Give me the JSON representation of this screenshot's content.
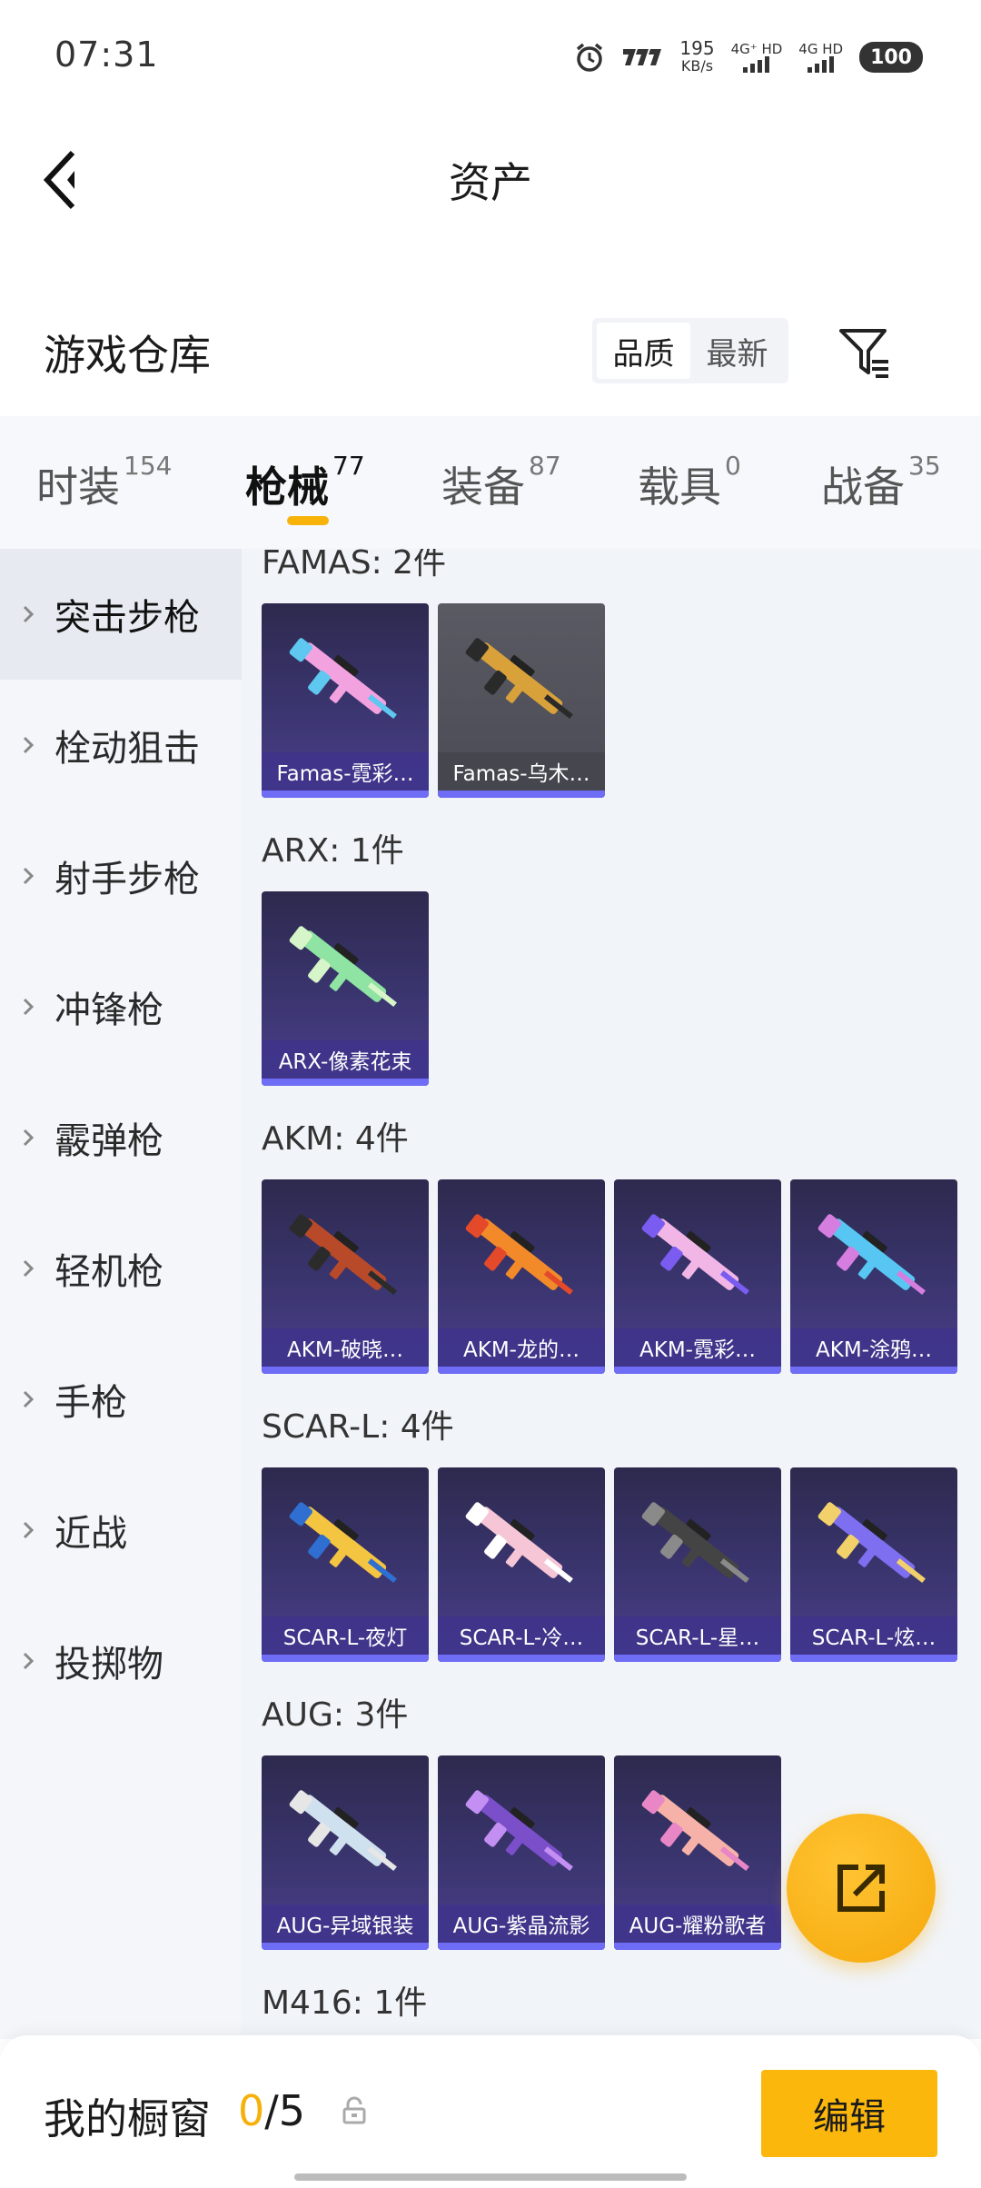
{
  "status_bar": {
    "time": "07:31",
    "speed_value": "195",
    "speed_unit": "KB/s",
    "net1": "4G⁺ HD",
    "net2": "4G HD",
    "battery": "100"
  },
  "header": {
    "title": "资产"
  },
  "section": {
    "title": "游戏仓库",
    "sort_quality": "品质",
    "sort_newest": "最新"
  },
  "tabs": [
    {
      "label": "时装",
      "count": "154"
    },
    {
      "label": "枪械",
      "count": "77"
    },
    {
      "label": "装备",
      "count": "87"
    },
    {
      "label": "载具",
      "count": "0"
    },
    {
      "label": "战备",
      "count": "35"
    }
  ],
  "sidebar": [
    {
      "label": "突击步枪"
    },
    {
      "label": "栓动狙击"
    },
    {
      "label": "射手步枪"
    },
    {
      "label": "冲锋枪"
    },
    {
      "label": "霰弹枪"
    },
    {
      "label": "轻机枪"
    },
    {
      "label": "手枪"
    },
    {
      "label": "近战"
    },
    {
      "label": "投掷物"
    }
  ],
  "groups": [
    {
      "title": "FAMAS: 2件",
      "items": [
        "Famas-霓彩…",
        "Famas-乌木…"
      ]
    },
    {
      "title": "ARX: 1件",
      "items": [
        "ARX-像素花束"
      ]
    },
    {
      "title": "AKM: 4件",
      "items": [
        "AKM-破晓…",
        "AKM-龙的…",
        "AKM-霓彩…",
        "AKM-涂鸦…"
      ]
    },
    {
      "title": "SCAR-L: 4件",
      "items": [
        "SCAR-L-夜灯",
        "SCAR-L-冷…",
        "SCAR-L-星…",
        "SCAR-L-炫…"
      ]
    },
    {
      "title": "AUG: 3件",
      "items": [
        "AUG-异域银装",
        "AUG-紫晶流影",
        "AUG-耀粉歌者"
      ]
    },
    {
      "title": "M416: 1件",
      "items": [
        ""
      ]
    }
  ],
  "bottom": {
    "showcase_label": "我的橱窗",
    "showcase_current": "0",
    "showcase_total": "/5",
    "edit_label": "编辑"
  },
  "colors": {
    "accent": "#fbb70b",
    "card_bg": "#3b3570",
    "card_stripe": "#6f6cf5"
  },
  "icons": {
    "back": "back-arrow-icon",
    "filter": "filter-icon",
    "fab": "share-icon",
    "lock": "lock-icon"
  }
}
